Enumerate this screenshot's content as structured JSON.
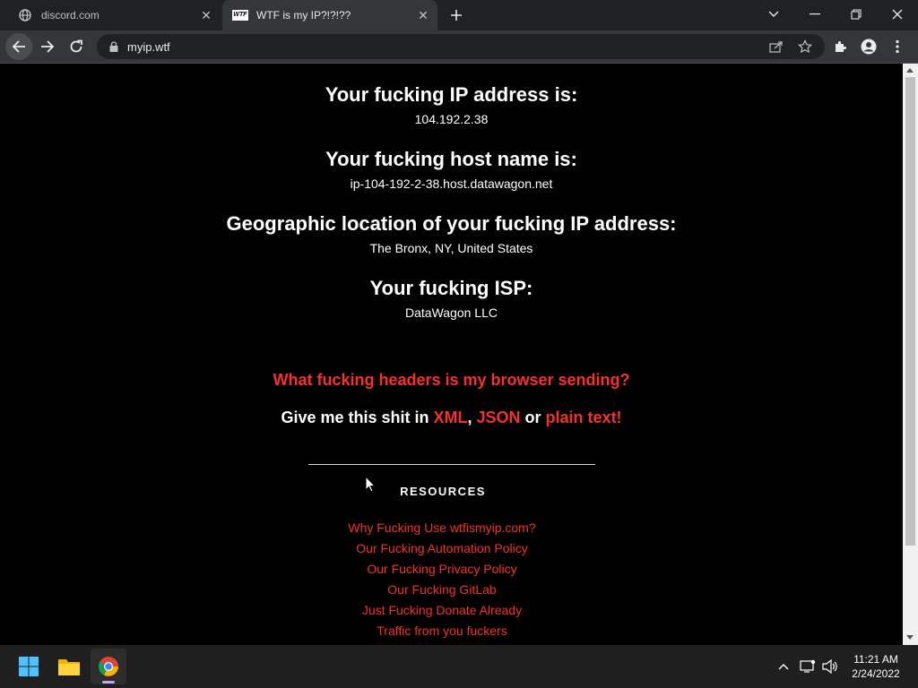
{
  "browser": {
    "tabs": [
      {
        "title": "discord.com",
        "icon": "globe-icon"
      },
      {
        "title": "WTF is my IP?!?!??",
        "icon": "wtf-favicon"
      }
    ],
    "url": "myip.wtf",
    "favicon_text": "WTF"
  },
  "page": {
    "sections": [
      {
        "heading": "Your fucking IP address is:",
        "value": "104.192.2.38"
      },
      {
        "heading": "Your fucking host name is:",
        "value": "ip-104-192-2-38.host.datawagon.net"
      },
      {
        "heading": "Geographic location of your fucking IP address:",
        "value": "The Bronx, NY, United States"
      },
      {
        "heading": "Your fucking ISP:",
        "value": "DataWagon LLC"
      }
    ],
    "headers_link": "What fucking headers is my browser sending?",
    "give_prefix": "Give me this shit in ",
    "xml": "XML",
    "comma": ", ",
    "json": "JSON",
    "or": " or ",
    "plain": "plain text!",
    "resources_title": "RESOURCES",
    "resources": [
      "Why Fucking Use wtfismyip.com?",
      "Our Fucking Automation Policy",
      "Our Fucking Privacy Policy",
      "Our Fucking GitLab",
      "Just Fucking Donate Already",
      "Traffic from you fuckers"
    ]
  },
  "taskbar": {
    "time": "11:21 AM",
    "date": "2/24/2022"
  },
  "colors": {
    "link_red": "#f5312b",
    "background": "#000000"
  }
}
